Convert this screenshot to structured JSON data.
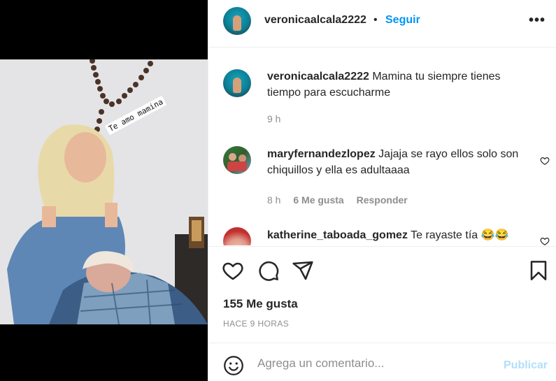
{
  "post": {
    "owner": "veronicaalcala2222",
    "separator": "•",
    "follow_label": "Seguir",
    "more_label": "•••",
    "photo_overlay_text": "Te amo mamina"
  },
  "comments": [
    {
      "username": "veronicaalcala2222",
      "text": "Mamina tu siempre tienes tiempo para escucharme",
      "age": "9 h"
    },
    {
      "username": "maryfernandezlopez",
      "text": "Jajaja se rayo ellos solo son chiquillos y ella es adultaaaa",
      "age": "8 h",
      "likes": "6 Me gusta",
      "reply_label": "Responder"
    },
    {
      "username": "katherine_taboada_gomez",
      "text": "Te rayaste tía 😂😂"
    }
  ],
  "stats": {
    "likes": "155 Me gusta",
    "time_ago": "HACE 9 HORAS"
  },
  "composer": {
    "placeholder": "Agrega un comentario...",
    "publish_label": "Publicar"
  },
  "colors": {
    "accent": "#0095f6",
    "publish_disabled": "#b2dffc",
    "muted": "#8e8e8e"
  },
  "icons": [
    "heart-icon",
    "comment-icon",
    "share-icon",
    "bookmark-icon",
    "emoji-icon",
    "more-icon"
  ]
}
